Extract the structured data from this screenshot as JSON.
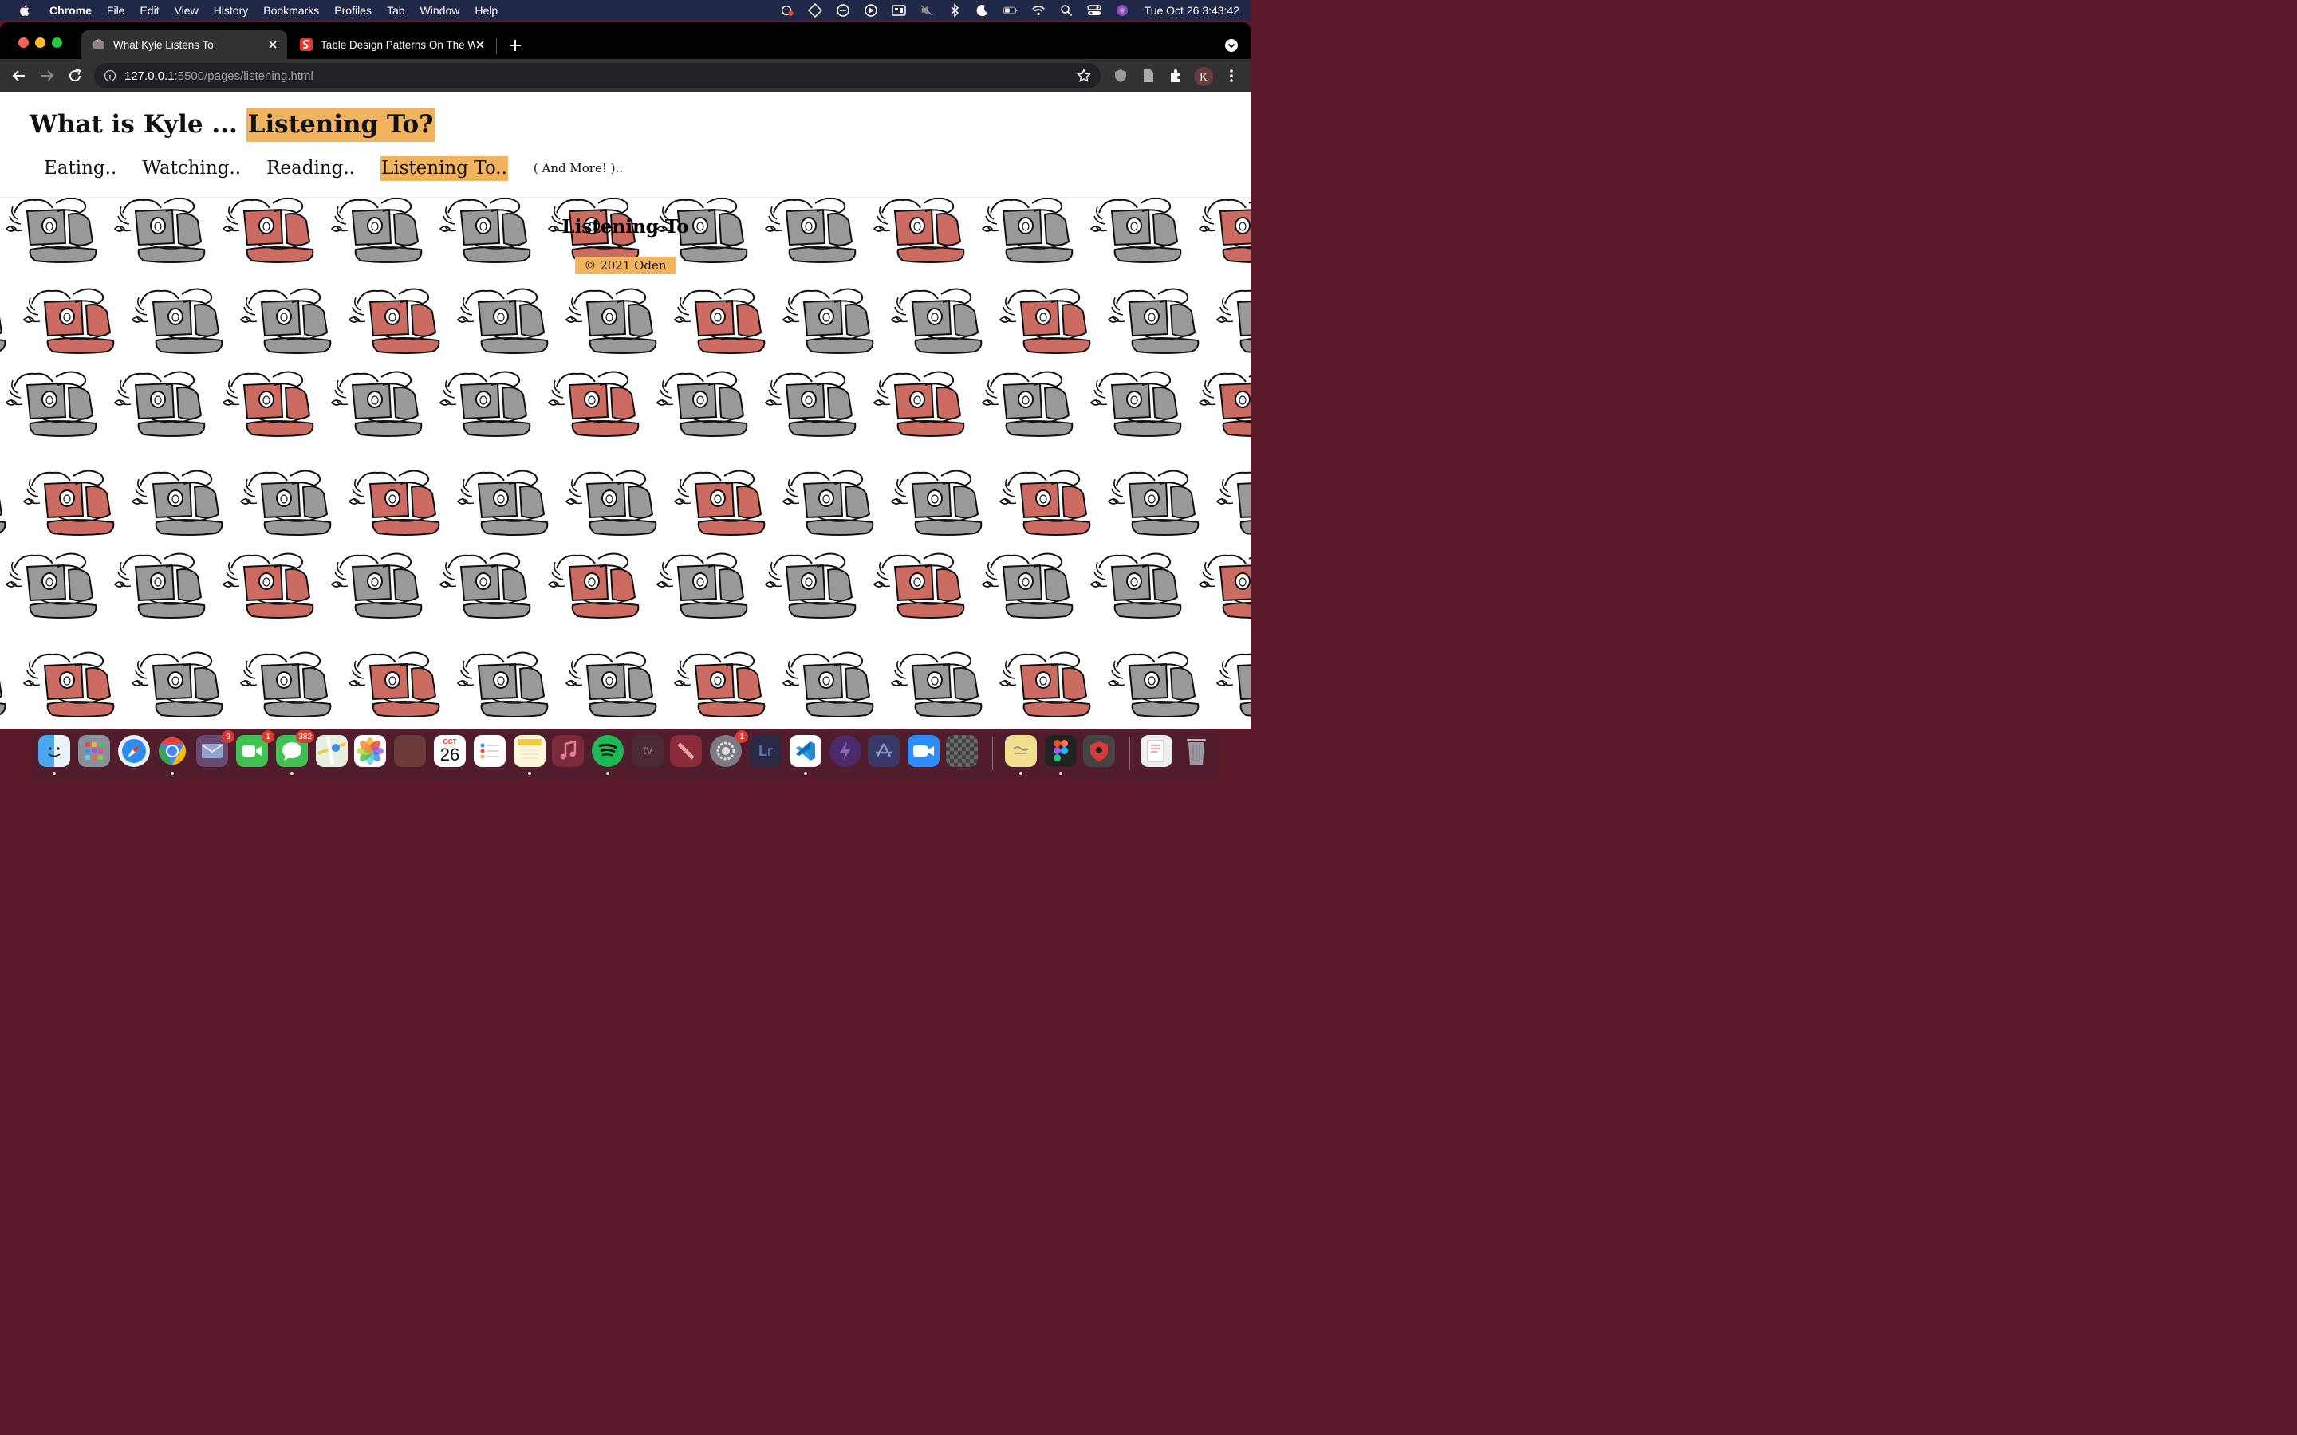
{
  "menubar": {
    "app_name": "Chrome",
    "items": [
      "File",
      "Edit",
      "View",
      "History",
      "Bookmarks",
      "Profiles",
      "Tab",
      "Window",
      "Help"
    ],
    "clock": "Tue Oct 26  3:43:42"
  },
  "browser": {
    "tabs": [
      {
        "title": "What Kyle Listens To",
        "active": true
      },
      {
        "title": "Table Design Patterns On The W",
        "active": false
      }
    ],
    "url_host": "127.0.0.1",
    "url_path": ":5500/pages/listening.html",
    "profile_initial": "K"
  },
  "site": {
    "title_prefix": "What is Kyle ... ",
    "title_highlight": "Listening To?",
    "nav": [
      {
        "label": "Eating..",
        "active": false
      },
      {
        "label": "Watching..",
        "active": false
      },
      {
        "label": "Reading..",
        "active": false
      },
      {
        "label": "Listening To..",
        "active": true
      }
    ],
    "more_label": "( And More! )..",
    "section_heading": "Listening To",
    "footer": "© 2021 Oden",
    "accent": "#f2b35e",
    "pattern_colors": {
      "gray": "#999999",
      "red": "#cc6b61"
    }
  },
  "dock": {
    "badges": {
      "mail": "9",
      "facetime": "1",
      "messages": "382",
      "settings": "1"
    },
    "calendar": {
      "month": "OCT",
      "day": "26"
    },
    "tv_label": "tv",
    "lightroom_label": "Lr"
  }
}
